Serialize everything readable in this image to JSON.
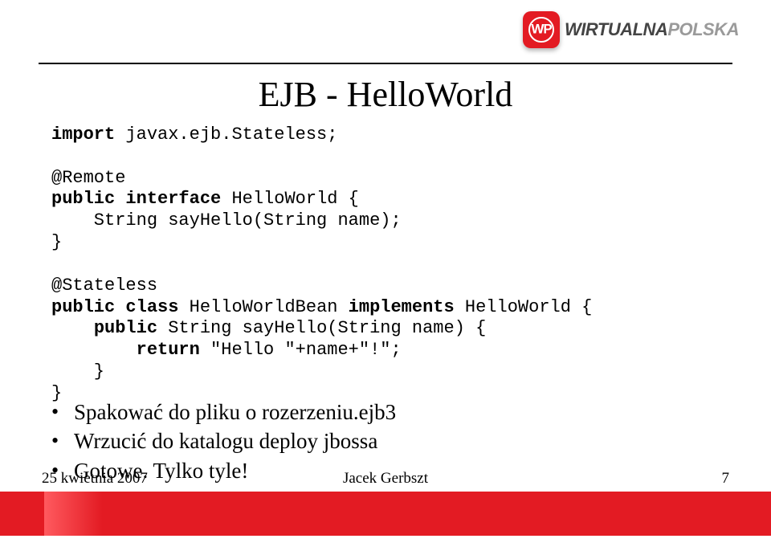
{
  "logo": {
    "brand_left": "WIRTUALNA",
    "brand_right": "POLSKA",
    "badge": "WP"
  },
  "title": "EJB - HelloWorld",
  "code": {
    "l1_kw": "import",
    "l1_rest": " javax.ejb.Stateless;",
    "l2": "",
    "l3": "@Remote",
    "l4_kw1": "public",
    "l4_mid": " ",
    "l4_kw2": "interface",
    "l4_rest": " HelloWorld {",
    "l5": "    String sayHello(String name);",
    "l6": "}",
    "l7": "",
    "l8": "@Stateless",
    "l9_kw1": "public",
    "l9_mid": " ",
    "l9_kw2": "class",
    "l9_rest": " HelloWorldBean ",
    "l9_kw3": "implements",
    "l9_rest2": " HelloWorld {",
    "l10_pad": "    ",
    "l10_kw": "public",
    "l10_rest": " String sayHello(String name) {",
    "l11_pad": "        ",
    "l11_kw": "return",
    "l11_rest": " \"Hello \"+name+\"!\";",
    "l12": "    }",
    "l13": "}"
  },
  "bullets": [
    "Spakować do pliku o rozerzeniu.ejb3",
    "Wrzucić do katalogu deploy jbossa",
    "Gotowe. Tylko tyle!"
  ],
  "footer": {
    "date": "25 kwietnia 2007",
    "author": "Jacek Gerbszt",
    "page": "7"
  }
}
